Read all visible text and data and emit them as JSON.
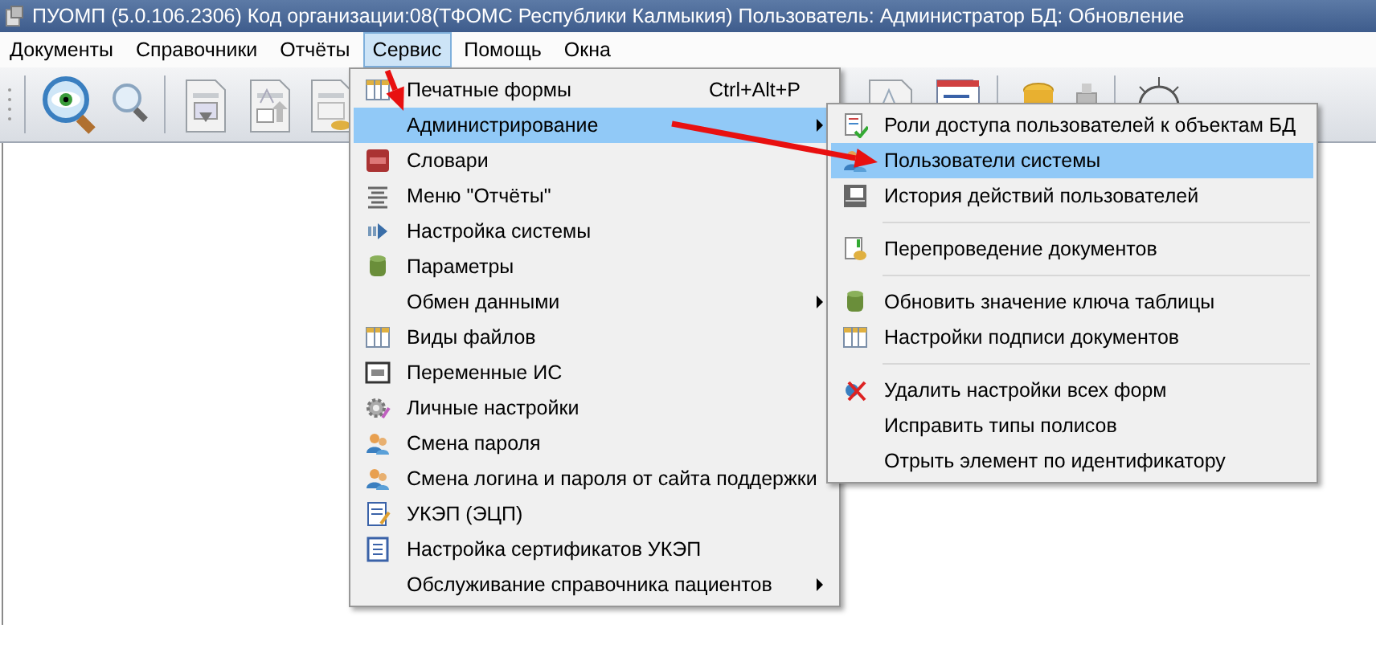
{
  "window": {
    "title": "ПУОМП (5.0.106.2306)  Код организации:08(ТФОМС Республики Калмыкия)  Пользователь: Администратор БД: Обновление"
  },
  "menu_bar": [
    {
      "label": "Документы",
      "selected": false
    },
    {
      "label": "Справочники",
      "selected": false
    },
    {
      "label": "Отчёты",
      "selected": false
    },
    {
      "label": "Сервис",
      "selected": true
    },
    {
      "label": "Помощь",
      "selected": false
    },
    {
      "label": "Окна",
      "selected": false
    }
  ],
  "service_menu": [
    {
      "kind": "item",
      "label": "Печатные формы",
      "shortcut": "Ctrl+Alt+P",
      "submenu": false,
      "selected": false
    },
    {
      "kind": "item",
      "label": "Администрирование",
      "submenu": true,
      "selected": true
    },
    {
      "kind": "item",
      "label": "Словари",
      "submenu": false,
      "selected": false
    },
    {
      "kind": "item",
      "label": "Меню \"Отчёты\"",
      "submenu": false,
      "selected": false
    },
    {
      "kind": "item",
      "label": "Настройка системы",
      "submenu": false,
      "selected": false
    },
    {
      "kind": "item",
      "label": "Параметры",
      "submenu": false,
      "selected": false
    },
    {
      "kind": "item",
      "label": "Обмен данными",
      "submenu": true,
      "selected": false
    },
    {
      "kind": "item",
      "label": "Виды файлов",
      "submenu": false,
      "selected": false
    },
    {
      "kind": "item",
      "label": "Переменные ИС",
      "submenu": false,
      "selected": false
    },
    {
      "kind": "item",
      "label": "Личные настройки",
      "submenu": false,
      "selected": false
    },
    {
      "kind": "item",
      "label": "Смена пароля",
      "submenu": false,
      "selected": false
    },
    {
      "kind": "item",
      "label": "Смена логина и пароля от сайта поддержки",
      "submenu": false,
      "selected": false
    },
    {
      "kind": "item",
      "label": "УКЭП (ЭЦП)",
      "submenu": false,
      "selected": false
    },
    {
      "kind": "item",
      "label": "Настройка сертификатов УКЭП",
      "submenu": false,
      "selected": false
    },
    {
      "kind": "item",
      "label": "Обслуживание справочника пациентов",
      "submenu": true,
      "selected": false
    }
  ],
  "admin_submenu": [
    {
      "kind": "item",
      "label": "Роли доступа пользователей к объектам БД",
      "selected": false
    },
    {
      "kind": "item",
      "label": "Пользователи системы",
      "selected": true
    },
    {
      "kind": "item",
      "label": "История действий пользователей",
      "selected": false
    },
    {
      "kind": "separator"
    },
    {
      "kind": "item",
      "label": "Перепроведение документов",
      "selected": false
    },
    {
      "kind": "separator"
    },
    {
      "kind": "item",
      "label": "Обновить значение ключа таблицы",
      "selected": false
    },
    {
      "kind": "item",
      "label": "Настройки подписи документов",
      "selected": false
    },
    {
      "kind": "separator"
    },
    {
      "kind": "item",
      "label": "Удалить настройки всех форм",
      "selected": false
    },
    {
      "kind": "item",
      "label": "Исправить типы полисов",
      "selected": false
    },
    {
      "kind": "item",
      "label": "Отрыть элемент по идентификатору",
      "selected": false
    }
  ],
  "annotations": [
    {
      "kind": "arrow"
    },
    {
      "kind": "arrow"
    }
  ]
}
